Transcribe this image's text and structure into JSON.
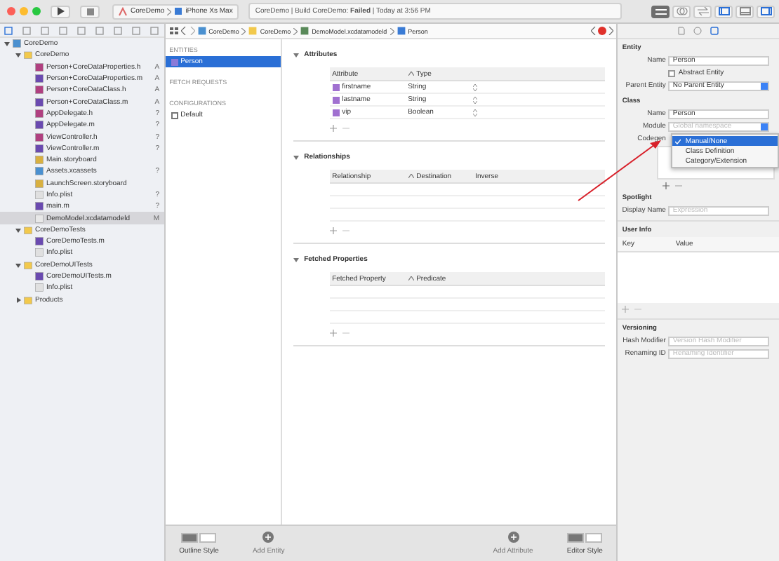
{
  "toolbar": {
    "scheme": "CoreDemo",
    "device": "iPhone Xs Max",
    "status": "CoreDemo | Build CoreDemo: **Failed** | Today at 3:56 PM"
  },
  "navigator": {
    "tree": [
      {
        "name": "CoreDemo",
        "kind": "project",
        "expanded": true,
        "selected": false,
        "children": [
          {
            "name": "CoreDemo",
            "kind": "group",
            "expanded": true,
            "selected": false,
            "children": [
              {
                "name": "Person+CoreDataProperties.h",
                "kind": "h",
                "badge": "A",
                "selected": false
              },
              {
                "name": "Person+CoreDataProperties.m",
                "kind": "m",
                "badge": "A",
                "selected": false
              },
              {
                "name": "Person+CoreDataClass.h",
                "kind": "h",
                "badge": "A",
                "selected": false
              },
              {
                "name": "Person+CoreDataClass.m",
                "kind": "m",
                "badge": "A",
                "selected": false
              },
              {
                "name": "AppDelegate.h",
                "kind": "h",
                "badge": "?",
                "selected": false
              },
              {
                "name": "AppDelegate.m",
                "kind": "m",
                "badge": "?",
                "selected": false
              },
              {
                "name": "ViewController.h",
                "kind": "h",
                "badge": "?",
                "selected": false
              },
              {
                "name": "ViewController.m",
                "kind": "m",
                "badge": "?",
                "selected": false
              },
              {
                "name": "Main.storyboard",
                "kind": "storyboard",
                "selected": false
              },
              {
                "name": "Assets.xcassets",
                "kind": "assets",
                "badge": "?",
                "selected": false
              },
              {
                "name": "LaunchScreen.storyboard",
                "kind": "storyboard",
                "selected": false
              },
              {
                "name": "Info.plist",
                "kind": "plist",
                "badge": "?",
                "selected": false
              },
              {
                "name": "main.m",
                "kind": "m",
                "badge": "?",
                "selected": false
              },
              {
                "name": "DemoModel.xcdatamodeld",
                "kind": "model",
                "badge": "M",
                "selected": true
              }
            ]
          },
          {
            "name": "CoreDemoTests",
            "kind": "group",
            "expanded": true,
            "selected": false,
            "children": [
              {
                "name": "CoreDemoTests.m",
                "kind": "m",
                "selected": false
              },
              {
                "name": "Info.plist",
                "kind": "plist",
                "selected": false
              }
            ]
          },
          {
            "name": "CoreDemoUITests",
            "kind": "group",
            "expanded": true,
            "selected": false,
            "children": [
              {
                "name": "CoreDemoUITests.m",
                "kind": "m",
                "selected": false
              },
              {
                "name": "Info.plist",
                "kind": "plist",
                "selected": false
              }
            ]
          },
          {
            "name": "Products",
            "kind": "group",
            "expanded": false,
            "selected": false
          }
        ]
      }
    ]
  },
  "jump_bar": [
    "CoreDemo",
    "CoreDemo",
    "DemoModel.xcdatamodeld",
    "Person"
  ],
  "entities_panel": {
    "entities_heading": "ENTITIES",
    "entities": [
      {
        "name": "Person",
        "selected": true
      }
    ],
    "fetch_heading": "FETCH REQUESTS",
    "config_heading": "CONFIGURATIONS",
    "configurations": [
      {
        "name": "Default",
        "selected": false
      }
    ]
  },
  "editor": {
    "sections": [
      {
        "title": "Attributes",
        "expanded": true,
        "columns": [
          "Attribute",
          "Type"
        ],
        "rows": [
          [
            "firstname",
            "String"
          ],
          [
            "lastname",
            "String"
          ],
          [
            "vip",
            "Boolean"
          ]
        ]
      },
      {
        "title": "Relationships",
        "expanded": true,
        "columns": [
          "Relationship",
          "Destination",
          "Inverse"
        ]
      },
      {
        "title": "Fetched Properties",
        "expanded": true,
        "columns": [
          "Fetched Property",
          "Predicate"
        ]
      }
    ]
  },
  "bottom_bar": {
    "outline_style": "Outline Style",
    "add_entity": "Add Entity",
    "add_attribute": "Add Attribute",
    "editor_style": "Editor Style"
  },
  "inspector": {
    "entity_heading": "Entity",
    "name_label": "Name",
    "name": "Person",
    "abstract_label": "Abstract Entity",
    "abstract": false,
    "parent_label": "Parent Entity",
    "parent": "No Parent Entity",
    "class_heading": "Class",
    "class_name_label": "Name",
    "class_name": "Person",
    "module_label": "Module",
    "module_placeholder": "Global namespace",
    "codegen_label": "Codegen",
    "codegen_menu": [
      {
        "label": "Manual/None",
        "selected": true
      },
      {
        "label": "Class Definition",
        "selected": false
      },
      {
        "label": "Category/Extension",
        "selected": false
      }
    ],
    "spotlight_heading": "Spotlight",
    "display_label": "Display Name",
    "display_placeholder": "Expression",
    "user_info_heading": "User Info",
    "user_info_columns": [
      "Key",
      "Value"
    ],
    "versioning_heading": "Versioning",
    "hash_label": "Hash Modifier",
    "hash_placeholder": "Version Hash Modifier",
    "renaming_label": "Renaming ID",
    "renaming_placeholder": "Renaming Identifier"
  }
}
